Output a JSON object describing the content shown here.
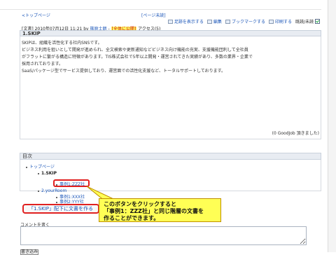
{
  "nav": {
    "top_page": "<トップページ",
    "page_unpublished": "[ページ未読]"
  },
  "toolbar": {
    "show_readers": "足跡を表示する",
    "edit": "編集",
    "bookmark": "ブックマークする",
    "print": "印刷する",
    "read_unread": "既読/未読"
  },
  "doc": {
    "meta_prefix": "[文書] 2010年07月12日 11:21 by ",
    "author": "篠原士朗",
    "separator": " - ",
    "scope": "[全体に公開]",
    "access": "アクセス(5)",
    "title": "1.SKIP",
    "body": [
      "SKIPは、組織を活性化する社内SNSです。",
      "ビジネス利用を狙いとして開発が進められ、全文検索や更新通知などビジネス向け機能の充実、支援機能団利して全社員",
      "がフラットに繋がる構造に特徴があります。TIS株式会社で5年以上開発・運営されてきた実績があり、多数の業界・企業で",
      "採用されております。",
      "SaaS/パッケージ型でサービス提供しており、運営面での活性化支援など、トータルサポートしております。"
    ],
    "goodjob": "(0 GoodJob 頂きました)"
  },
  "toc": {
    "heading": "目次",
    "items": [
      "トップページ",
      "1.SKIP",
      "事例1:ZZZ社",
      "2.yourRoom",
      "事例1:XXX社",
      "事例2:YYY社"
    ]
  },
  "create_button": "「1.SKIP」配下に文書を作る",
  "callout": {
    "line1": "このボタンをクリックすると",
    "line2": "「事例1：ZZZ社」と同じ階層の文書を",
    "line3": "作ることができます。"
  },
  "comment": {
    "label": "コメントを書く",
    "value": "",
    "submit": "書き込み"
  },
  "colors": {
    "link": "#1a55b8",
    "highlight_red": "#e02020",
    "callout_bg": "#ffff55",
    "badge_bg": "#ffff66"
  }
}
